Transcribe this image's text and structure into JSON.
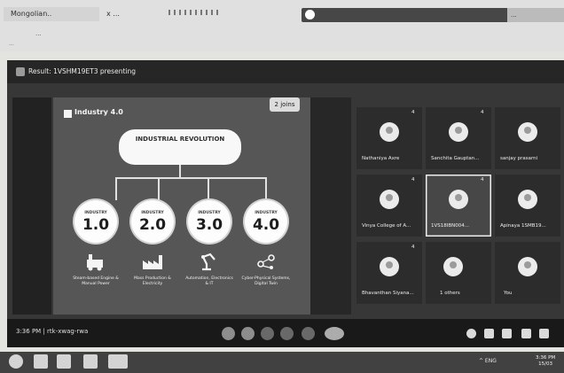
{
  "browser": {
    "tab1": "Mongolian..",
    "tab2": "x ...",
    "address_right": "...",
    "url_text": "...",
    "bookmark_text": "..."
  },
  "meeting": {
    "title": "Result: 1VSHM19ET3 presenting",
    "clock": "3:36 PM",
    "meeting_code": "rtk-xwag-rwa"
  },
  "slide": {
    "brand": "Industry 4.0",
    "badge": "2 joins",
    "revolution_title": "INDUSTRIAL REVOLUTION",
    "revolution_subtitle": "",
    "stages": [
      {
        "label": "INDUSTRY",
        "number": "1.0",
        "caption": "Steam-based Engine & Manual Power",
        "icon": "steam-engine-icon"
      },
      {
        "label": "INDUSTRY",
        "number": "2.0",
        "caption": "Mass Production & Electricity",
        "icon": "factory-icon"
      },
      {
        "label": "INDUSTRY",
        "number": "3.0",
        "caption": "Automation, Electronics & IT",
        "icon": "robot-arm-icon"
      },
      {
        "label": "INDUSTRY",
        "number": "4.0",
        "caption": "Cyber-Physical Systems, Digital Twin",
        "icon": "network-icon"
      }
    ]
  },
  "participants": [
    {
      "name": "Nathaniya Axre",
      "badge": "4"
    },
    {
      "name": "Sanchita Gauptan...",
      "badge": "4"
    },
    {
      "name": "sanjay prasarni",
      "badge": ""
    },
    {
      "name": "Vinya College of A...",
      "badge": "4"
    },
    {
      "name": "1VS18IBN004...",
      "badge": "4"
    },
    {
      "name": "Apinaya 1SMB19...",
      "badge": ""
    },
    {
      "name": "Bhavanthan Siyana...",
      "badge": "4"
    },
    {
      "name": "1 others",
      "badge": ""
    },
    {
      "name": "You",
      "badge": ""
    }
  ],
  "taskbar": {
    "tray": "^ ENG",
    "time": "3:36 PM",
    "date": "15/03"
  }
}
